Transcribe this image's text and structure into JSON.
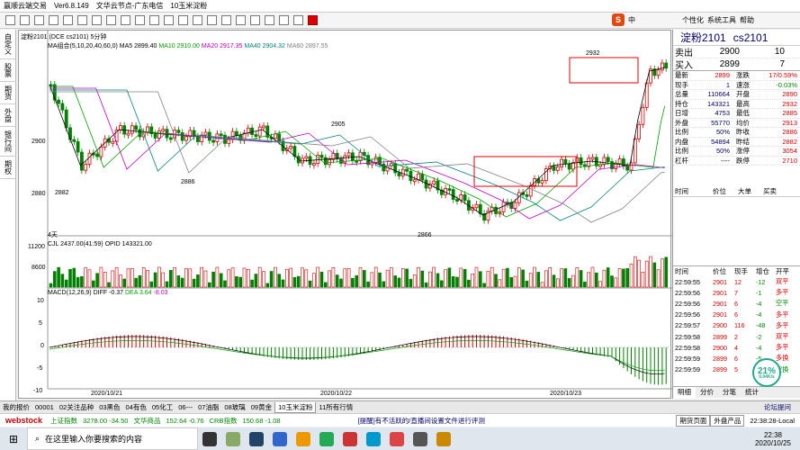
{
  "titlebar": {
    "app": "赢顺云端交易",
    "version": "Ver6.8.149",
    "node": "文华云节点-广东电信",
    "tab": "10玉米淀粉"
  },
  "topright": {
    "logo": "S",
    "lang": "中",
    "menu1": "个性化",
    "menu2": "系统工具",
    "menu3": "帮助"
  },
  "leftbar": [
    "自定义",
    "股票",
    "期货",
    "外盘",
    "银行间",
    "期权"
  ],
  "chart": {
    "symbol": "淀粉2101",
    "code": "DCE cs2101",
    "period": "5分钟",
    "ma_label": "MA组合(5,10,20,40,60,0)",
    "ma5": "MA5 2899.40",
    "ma10": "MA10 2910.00",
    "ma20": "MA20 2917.35",
    "ma40": "MA40 2904.32",
    "ma60": "MA60 2897.55",
    "y_labels": [
      "2900",
      "2880"
    ],
    "vol_label": "CJL",
    "vol_info": "2437.00(41:59)",
    "opid": "OPID 143321.00",
    "vol_y": [
      "11200",
      "8600"
    ],
    "macd_label": "MACD(12,26,9)",
    "diff": "DIFF -0.37",
    "dea": "DEA 3.64",
    "macd_val": "-8.03",
    "macd_y": [
      "10",
      "5",
      "0",
      "-5",
      "-10"
    ],
    "dates": [
      "2020/10/21",
      "2020/10/22",
      "2020/10/23"
    ],
    "annotations": [
      "2932",
      "2905",
      "2882",
      "2886",
      "2866"
    ],
    "range": "4天"
  },
  "quote": {
    "name": "淀粉2101",
    "code": "cs2101",
    "sell": {
      "label": "卖出",
      "price": "2900",
      "qty": "10"
    },
    "buy": {
      "label": "买入",
      "price": "2899",
      "qty": "7"
    },
    "rows": [
      [
        "最新",
        "2899",
        "涨跌",
        "17/0.59%"
      ],
      [
        "现手",
        "1",
        "速涨",
        "-0.03%"
      ],
      [
        "总量",
        "110664",
        "开盘",
        "2890"
      ],
      [
        "持仓",
        "143321",
        "最高",
        "2932"
      ],
      [
        "日增",
        "4753",
        "最低",
        "2885"
      ],
      [
        "外盘",
        "55770",
        "均价",
        "2913"
      ],
      [
        "比例",
        "50%",
        "昨收",
        "2886"
      ],
      [
        "内盘",
        "54894",
        "昨结",
        "2882"
      ],
      [
        "比例",
        "50%",
        "涨停",
        "3054"
      ],
      [
        "杠杆",
        "----",
        "跌停",
        "2710"
      ]
    ],
    "tick_head": [
      "时间",
      "价位",
      "大单",
      "买卖"
    ],
    "trade_head": [
      "时间",
      "价位",
      "现手",
      "增仓",
      "开平"
    ],
    "trades": [
      [
        "22:59:55",
        "2901",
        "12",
        "-12",
        "双平"
      ],
      [
        "22:59:56",
        "2901",
        "7",
        "-1",
        "多平"
      ],
      [
        "22:59:56",
        "2901",
        "6",
        "-4",
        "空平"
      ],
      [
        "22:59:56",
        "2901",
        "6",
        "-4",
        "多平"
      ],
      [
        "22:59:57",
        "2900",
        "116",
        "-48",
        "多平"
      ],
      [
        "22:59:58",
        "2899",
        "2",
        "-2",
        "双平"
      ],
      [
        "22:59:58",
        "2900",
        "4",
        "-4",
        "多平"
      ],
      [
        "22:59:59",
        "2899",
        "6",
        "-5",
        "多换"
      ],
      [
        "22:59:59",
        "2899",
        "5",
        "-6",
        "空换"
      ]
    ],
    "tabs": [
      "明细",
      "分价",
      "分笔",
      "统计"
    ],
    "badge": "21%",
    "badge_sub": "0.04K/s"
  },
  "bottom_tabs": [
    "我的报价",
    "00001",
    "02关注品种",
    "03黑色",
    "04有色",
    "05化工",
    "06---",
    "07油脂",
    "08玻璃",
    "09黄金",
    "10玉米淀粉",
    "11所有行情"
  ],
  "bottom_right": "论坛提问",
  "status": {
    "brand": "webstock",
    "idx1": "上证指数",
    "idx1_val": "3278.00 -34.50",
    "idx2": "文华商品",
    "idx2_val": "152.64 -0.76",
    "idx3": "CRB指数",
    "idx3_val": "150.68 -1.08",
    "notice": "[提醒]有不活跃的/直播间设置文件进行评测",
    "btn1": "期货页面",
    "btn2": "外盘产品",
    "time": "22:38:28-Local"
  },
  "taskbar": {
    "search_placeholder": "在这里输入你要搜索的内容",
    "clock": "22:38",
    "date": "2020/10/25"
  },
  "colors": {
    "up": "#d00000",
    "down": "#008000",
    "ma5": "#000000",
    "ma10": "#00a000",
    "ma20": "#c000c0",
    "ma40": "#008080",
    "ma60": "#808080"
  }
}
